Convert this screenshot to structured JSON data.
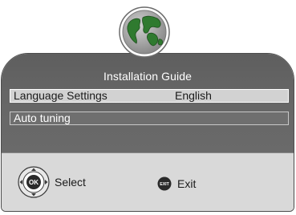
{
  "dialog": {
    "title": "Installation Guide",
    "rows": [
      {
        "label": "Language Settings",
        "value": "English"
      },
      {
        "label": "Auto tuning"
      }
    ]
  },
  "footer": {
    "ok_glyph": "OK",
    "select_label": "Select",
    "exit_glyph": "EXIT",
    "exit_label": "Exit"
  },
  "colors": {
    "panel": "#666666",
    "footer": "#d9d9d9",
    "selected_row": "#d2d2d2",
    "globe_land": "#2f7a2f",
    "globe_sea": "#a7a7a7"
  },
  "icons": [
    "globe-icon",
    "ok-dpad-icon",
    "exit-button-icon"
  ]
}
